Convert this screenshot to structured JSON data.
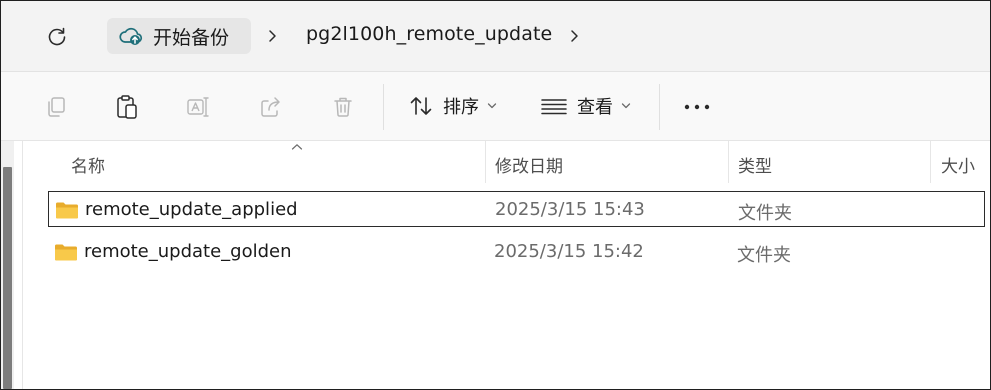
{
  "address_bar": {
    "root_label": "开始备份",
    "folder_label": "pg2l100h_remote_update"
  },
  "toolbar": {
    "sort_label": "排序",
    "view_label": "查看"
  },
  "columns": {
    "name": "名称",
    "modified": "修改日期",
    "type": "类型",
    "size": "大小"
  },
  "files": [
    {
      "name": "remote_update_applied",
      "modified": "2025/3/15 15:43",
      "type": "文件夹",
      "selected": true
    },
    {
      "name": "remote_update_golden",
      "modified": "2025/3/15 15:42",
      "type": "文件夹",
      "selected": false
    }
  ],
  "colors": {
    "accent": "#0f6cbd",
    "folder_yellow": "#f8c94a",
    "cloud_teal": "#1f6f7a"
  }
}
